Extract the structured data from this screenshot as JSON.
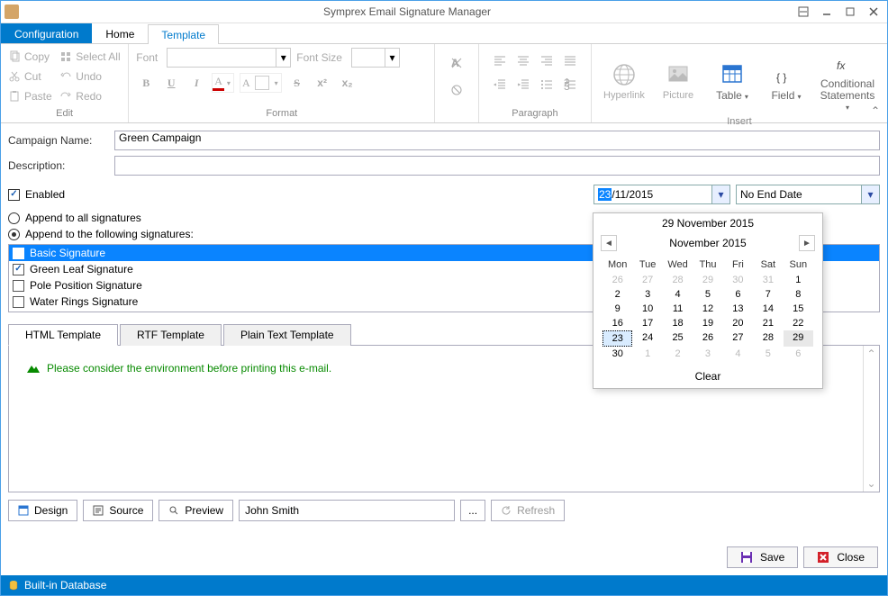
{
  "window": {
    "title": "Symprex Email Signature Manager"
  },
  "tabs": {
    "config": "Configuration",
    "home": "Home",
    "template": "Template"
  },
  "ribbon": {
    "edit": {
      "copy": "Copy",
      "select_all": "Select All",
      "cut": "Cut",
      "undo": "Undo",
      "paste": "Paste",
      "redo": "Redo",
      "label": "Edit"
    },
    "format": {
      "font_label": "Font",
      "size_label": "Font Size",
      "label": "Format"
    },
    "paragraph": {
      "label": "Paragraph"
    },
    "insert": {
      "hyperlink": "Hyperlink",
      "picture": "Picture",
      "table": "Table",
      "field": "Field",
      "conditional": "Conditional Statements",
      "label": "Insert"
    }
  },
  "form": {
    "campaign_label": "Campaign Name:",
    "campaign_value": "Green Campaign",
    "desc_label": "Description:",
    "desc_value": "",
    "enabled_label": "Enabled",
    "date_start": {
      "sel": "23",
      "rest": "/11/2015"
    },
    "date_end_label": "No End Date",
    "append_all": "Append to all signatures",
    "append_sel": "Append to the following signatures:"
  },
  "signatures": [
    {
      "label": "Basic Signature",
      "checked": false,
      "selected": true
    },
    {
      "label": "Green Leaf Signature",
      "checked": true,
      "selected": false
    },
    {
      "label": "Pole Position Signature",
      "checked": false,
      "selected": false
    },
    {
      "label": "Water Rings Signature",
      "checked": false,
      "selected": false
    }
  ],
  "template_tabs": {
    "html": "HTML Template",
    "rtf": "RTF Template",
    "plain": "Plain Text Template"
  },
  "editor": {
    "env_text": "Please consider the environment before printing this e-mail."
  },
  "toolbar": {
    "design": "Design",
    "source": "Source",
    "preview": "Preview",
    "name": "John Smith",
    "more": "...",
    "refresh": "Refresh"
  },
  "footer": {
    "save": "Save",
    "close": "Close"
  },
  "status": {
    "db": "Built-in Database"
  },
  "calendar": {
    "header": "29 November 2015",
    "month": "November 2015",
    "dow": [
      "Mon",
      "Tue",
      "Wed",
      "Thu",
      "Fri",
      "Sat",
      "Sun"
    ],
    "weeks": [
      [
        {
          "d": "26",
          "o": true
        },
        {
          "d": "27",
          "o": true
        },
        {
          "d": "28",
          "o": true
        },
        {
          "d": "29",
          "o": true
        },
        {
          "d": "30",
          "o": true
        },
        {
          "d": "31",
          "o": true
        },
        {
          "d": "1"
        }
      ],
      [
        {
          "d": "2"
        },
        {
          "d": "3"
        },
        {
          "d": "4"
        },
        {
          "d": "5"
        },
        {
          "d": "6"
        },
        {
          "d": "7"
        },
        {
          "d": "8"
        }
      ],
      [
        {
          "d": "9"
        },
        {
          "d": "10"
        },
        {
          "d": "11"
        },
        {
          "d": "12"
        },
        {
          "d": "13"
        },
        {
          "d": "14"
        },
        {
          "d": "15"
        }
      ],
      [
        {
          "d": "16"
        },
        {
          "d": "17"
        },
        {
          "d": "18"
        },
        {
          "d": "19"
        },
        {
          "d": "20"
        },
        {
          "d": "21"
        },
        {
          "d": "22"
        }
      ],
      [
        {
          "d": "23",
          "sel": true
        },
        {
          "d": "24"
        },
        {
          "d": "25"
        },
        {
          "d": "26"
        },
        {
          "d": "27"
        },
        {
          "d": "28"
        },
        {
          "d": "29",
          "hl": true
        }
      ],
      [
        {
          "d": "30"
        },
        {
          "d": "1",
          "o": true
        },
        {
          "d": "2",
          "o": true
        },
        {
          "d": "3",
          "o": true
        },
        {
          "d": "4",
          "o": true
        },
        {
          "d": "5",
          "o": true
        },
        {
          "d": "6",
          "o": true
        }
      ]
    ],
    "clear": "Clear"
  }
}
